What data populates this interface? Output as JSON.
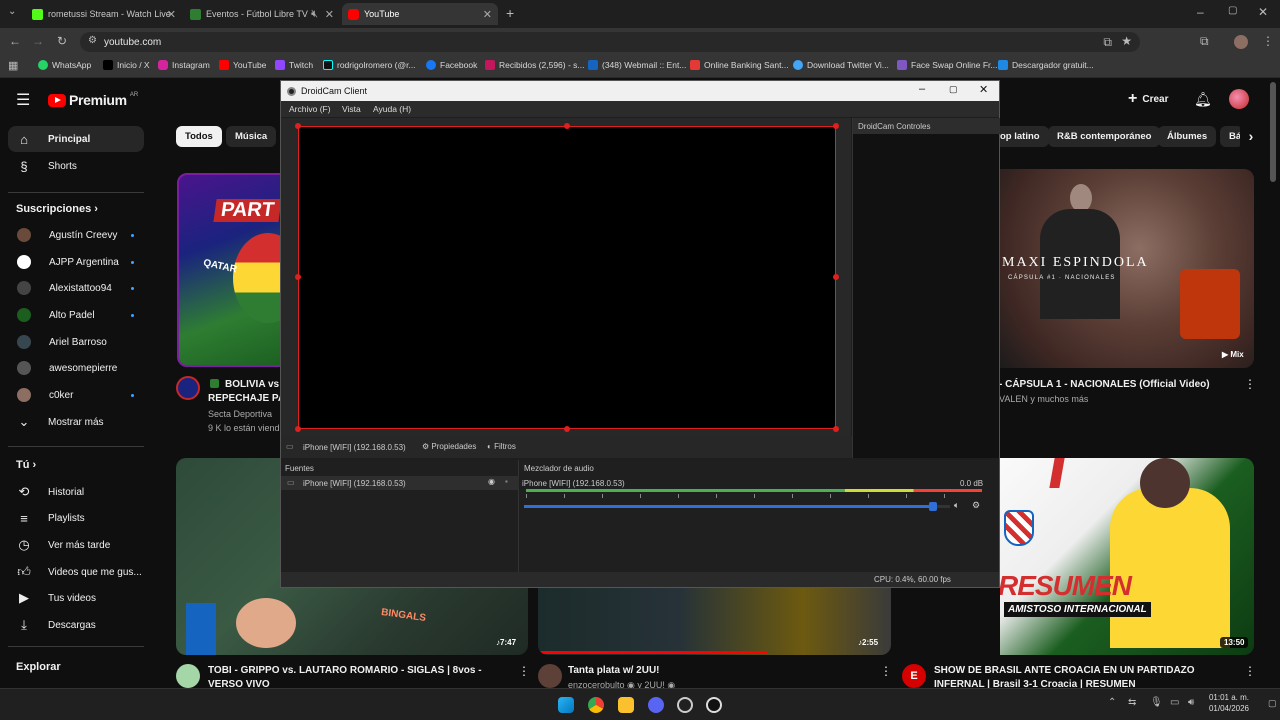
{
  "browser": {
    "tabs": [
      {
        "label": "rometussi Stream - Watch Live",
        "color": "#53fc18"
      },
      {
        "label": "Eventos - Fútbol Libre TV",
        "color": "#2e7d32"
      },
      {
        "label": "YouTube",
        "color": "#ff0000"
      }
    ],
    "url": "youtube.com",
    "bookmarks": [
      "WhatsApp",
      "Inicio / X",
      "Instagram",
      "YouTube",
      "Twitch",
      "rodrigolromero (@r...",
      "Facebook",
      "Recibidos (2,596) - s...",
      "(348) Webmail :: Ent...",
      "Online Banking Sant...",
      "Download Twitter Vi...",
      "Face Swap Online Fr...",
      "Descargador gratuit..."
    ]
  },
  "youtube": {
    "logo": "Premium",
    "logo_sup": "AR",
    "create_label": "Crear",
    "nav": [
      {
        "label": "Principal",
        "icon": "home-icon"
      },
      {
        "label": "Shorts",
        "icon": "shorts-icon"
      }
    ],
    "subs_header": "Suscripciones",
    "subs": [
      {
        "label": "Agustín Creevy",
        "color": "#6a4a3a"
      },
      {
        "label": "AJPP Argentina",
        "color": "#ffffff"
      },
      {
        "label": "Alexistattoo94",
        "color": "#444444"
      },
      {
        "label": "Alto Padel",
        "color": "#1b5e20"
      },
      {
        "label": "Ariel Barroso",
        "color": "#37474f"
      },
      {
        "label": "awesomepierre",
        "color": "#555555"
      },
      {
        "label": "c0ker",
        "color": "#8d6e63"
      }
    ],
    "show_more": "Mostrar más",
    "you_header": "Tú",
    "you": [
      {
        "label": "Historial",
        "icon": "history-icon"
      },
      {
        "label": "Playlists",
        "icon": "playlist-icon"
      },
      {
        "label": "Ver más tarde",
        "icon": "clock-icon"
      },
      {
        "label": "Videos que me gus...",
        "icon": "like-icon"
      },
      {
        "label": "Tus videos",
        "icon": "play-icon"
      },
      {
        "label": "Descargas",
        "icon": "download-icon"
      }
    ],
    "explore_header": "Explorar",
    "chips": [
      "Todos",
      "Música",
      "op latino",
      "R&B contemporáneo",
      "Álbumes",
      "Bá"
    ],
    "videos": {
      "v1": {
        "title": "BOLIVIA vs",
        "title2": "REPECHAJE PA",
        "channel": "Secta Deportiva",
        "stats": "9 K lo están viend",
        "thumb_text": "PART",
        "thumb_sub": "QATAR"
      },
      "v2": {
        "title": "- CÁPSULA 1 - NACIONALES (Official Video)",
        "channel": "VALEN y muchos más",
        "thumb_title": "MAXI ESPINDOLA",
        "thumb_sub": "CÁPSULA #1 · NACIONALES",
        "badge": "Mix"
      },
      "v3": {
        "title": "TOBI - GRIPPO vs. LAUTARO ROMARIO - SIGLAS | 8vos -",
        "title2": "VERSO VIVO",
        "duration": "7:47",
        "thumb_text": "BINGALS"
      },
      "v4": {
        "title": "Tanta plata w/ 2UU!",
        "channel": "enzocerobulto ◉ y 2UU! ◉",
        "duration": "2:55"
      },
      "v5": {
        "title": "SHOW DE BRASIL ANTE CROACIA EN UN PARTIDAZO",
        "title2": "INFERNAL | Brasil 3-1 Croacia | RESUMEN",
        "duration": "13:50",
        "thumb_text": "RESUMEN",
        "thumb_sub": "AMISTOSO INTERNACIONAL"
      }
    }
  },
  "droidcam": {
    "title": "DroidCam Client",
    "menu": [
      "Archivo (F)",
      "Vista",
      "Ayuda (H)"
    ],
    "controls_title": "DroidCam Controles",
    "source_name": "iPhone [WIFI] (192.168.0.53)",
    "properties": "Propiedades",
    "filters": "Filtros",
    "sources_title": "Fuentes",
    "mixer_title": "Mezclador de audio",
    "mixer_level": "0.0 dB",
    "volume": 0.96,
    "status": "CPU: 0.4%, 60.00 fps"
  },
  "taskbar": {
    "time": "01:01 a. m.",
    "date": "01/04/2026"
  }
}
